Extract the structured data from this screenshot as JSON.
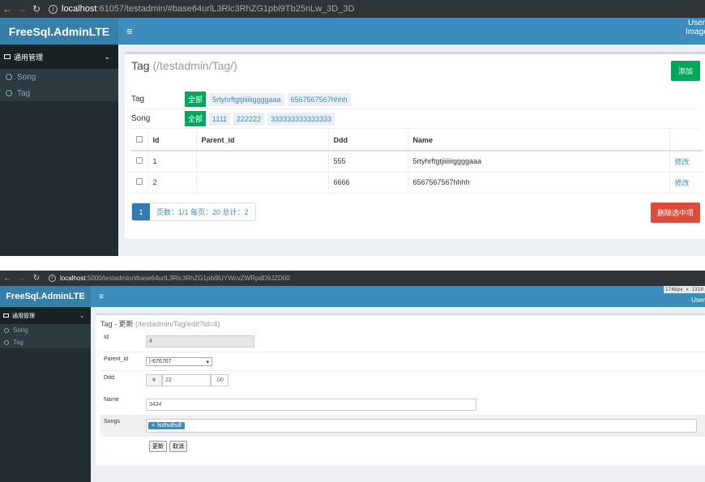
{
  "list_view": {
    "browser": {
      "url_host": "localhost",
      "url_path": ":61057/testadmin/#base64urlL3Rlc3RhZG1pbi9Tb25nLw_3D_3D"
    },
    "app": {
      "logo": "FreeSql.AdminLTE",
      "menu_icon": "≡",
      "user_image_alt": "User Image"
    },
    "sidebar": {
      "group_label": "通用管理",
      "items": [
        {
          "label": "Song"
        },
        {
          "label": "Tag"
        }
      ]
    },
    "page": {
      "title": "Tag",
      "path": "(/testadmin/Tag/)",
      "add_button": "添加"
    },
    "filters": [
      {
        "label": "Tag",
        "all": "全部",
        "options": [
          "5rtyhrftgtjiiiiiiggggaaa",
          "6567567567hhhh"
        ]
      },
      {
        "label": "Song",
        "all": "全部",
        "options": [
          "1111",
          "222222",
          "333333333333333"
        ]
      }
    ],
    "table": {
      "columns": [
        "Id",
        "Parent_id",
        "Ddd",
        "Name"
      ],
      "rows": [
        {
          "id": "1",
          "parent_id": "",
          "ddd": "555",
          "name": "5rtyhrftgtjiiiiiiggggaaa",
          "action": "修改"
        },
        {
          "id": "2",
          "parent_id": "",
          "ddd": "6666",
          "name": "6567567567hhhh",
          "action": "修改"
        }
      ]
    },
    "pagination": {
      "current_page": "1",
      "info": "页数：1/1 每页：20 总计：2"
    },
    "delete_button": "删除选中项"
  },
  "edit_view": {
    "browser": {
      "url_host": "localhost",
      "url_path": ":5000/testadmin/#base64urlL3Rlc3RhZG1pbi9UYWcvZWRpdD9JZD00"
    },
    "dev_tooltip": "1746px × 1310",
    "app": {
      "logo": "FreeSql.AdminLTE",
      "menu_icon": "≡",
      "user_label": "User"
    },
    "sidebar": {
      "group_label": "通用管理",
      "items": [
        {
          "label": "Song"
        },
        {
          "label": "Tag"
        }
      ]
    },
    "page": {
      "title": "Tag - 更新",
      "path": "(/testadmin/Tag/edit?Id=4)"
    },
    "form": {
      "id": {
        "label": "Id",
        "value": "4"
      },
      "parent_id": {
        "label": "Parent_id",
        "value": "|-676767"
      },
      "ddd": {
        "label": "Ddd",
        "prefix": "¥",
        "value": "22",
        "suffix": ".00"
      },
      "name": {
        "label": "Name",
        "value": "3434"
      },
      "songs": {
        "label": "Songs",
        "chips": [
          "fsdfsdfsdf"
        ]
      },
      "submit_button": "更新",
      "cancel_button": "取消"
    }
  }
}
